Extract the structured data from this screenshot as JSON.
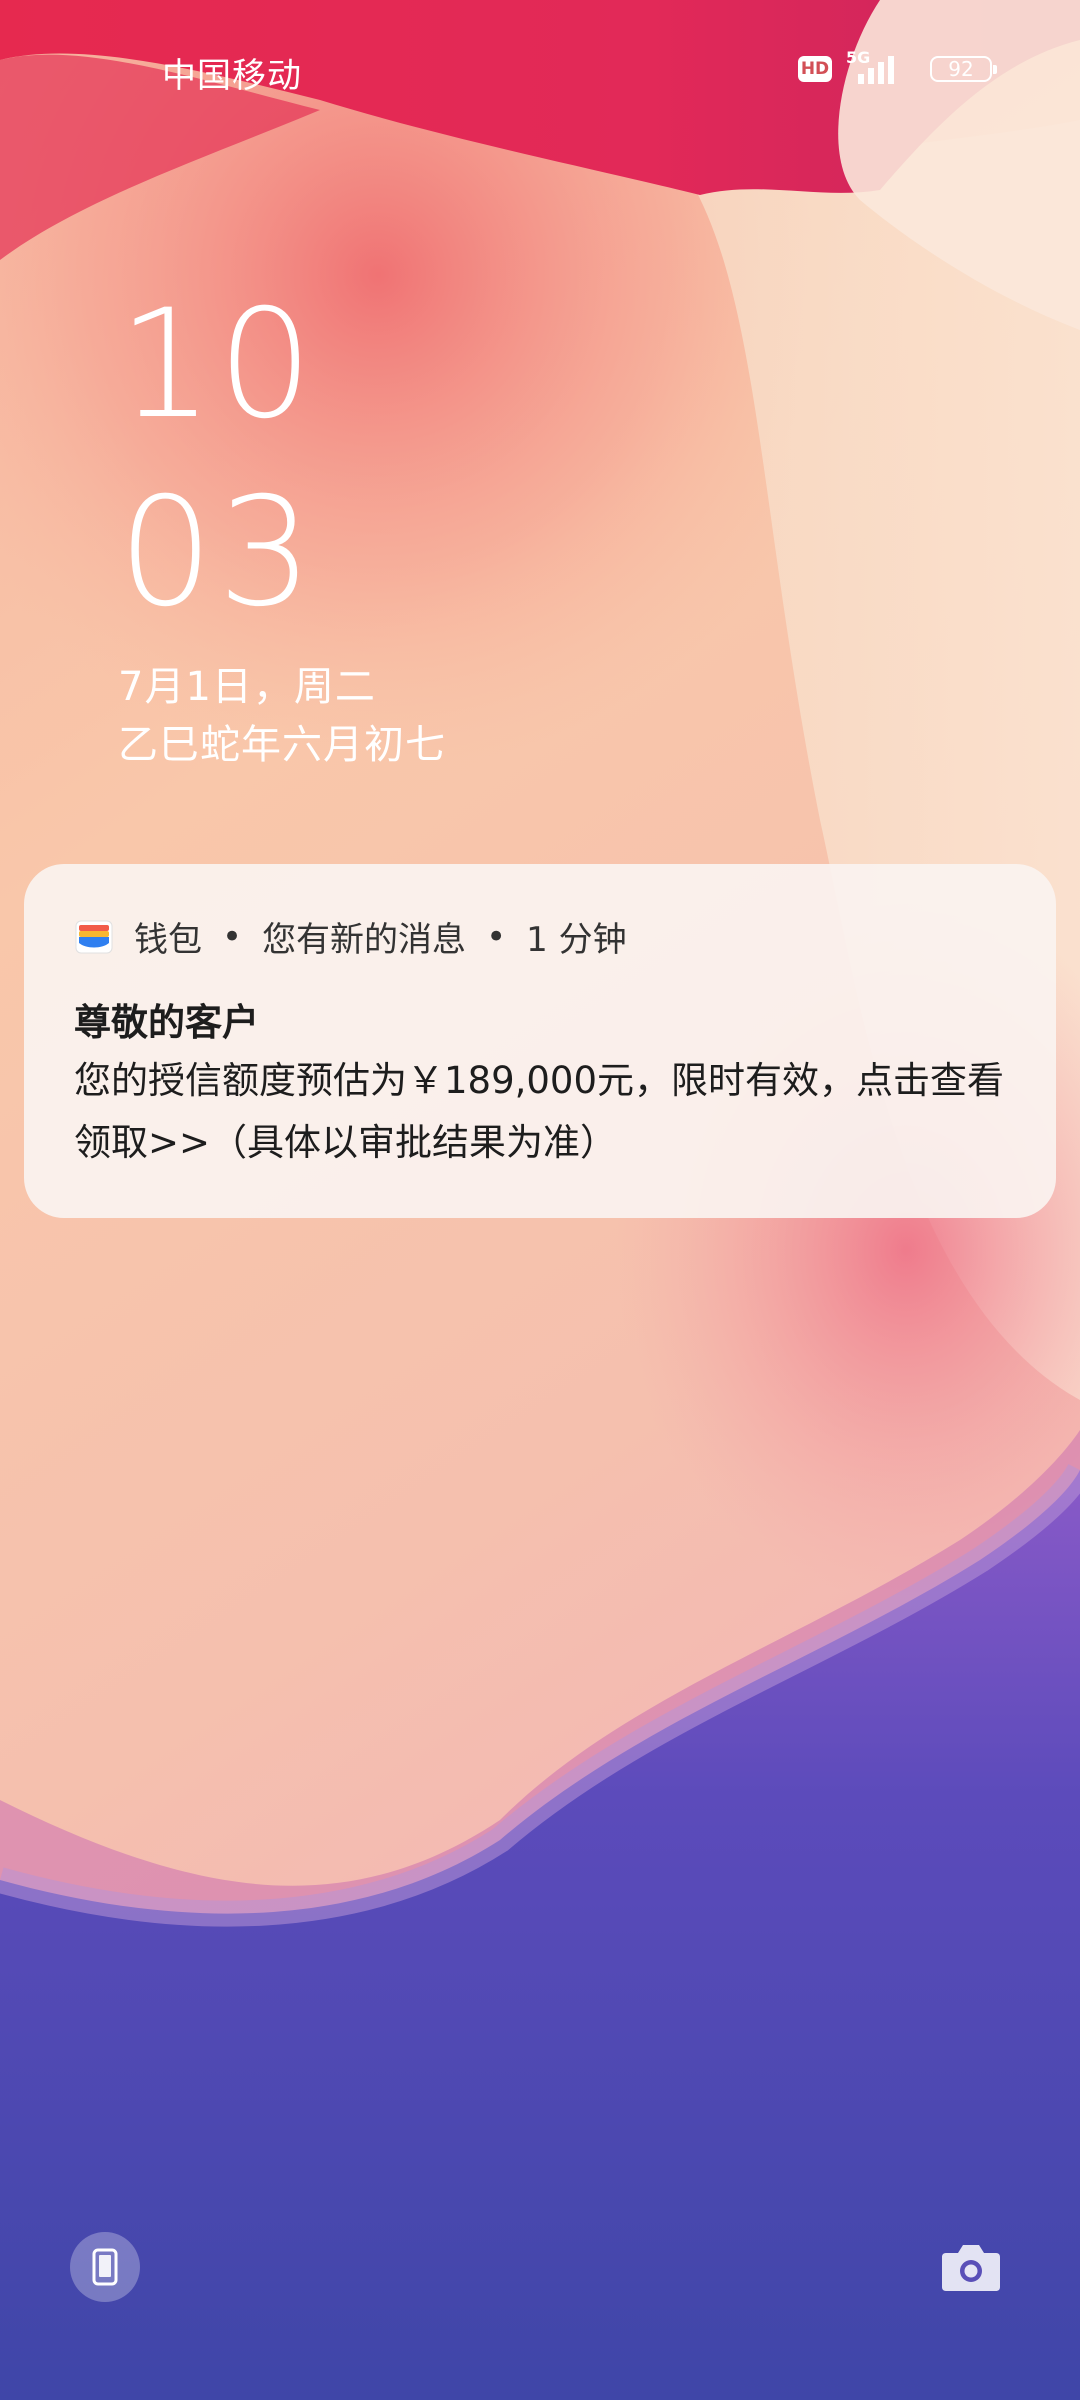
{
  "status_bar": {
    "carrier": "中国移动",
    "hd_label": "HD",
    "network_label": "5G",
    "battery_level": "92"
  },
  "clock": {
    "hour": "10",
    "minute": "03",
    "date": "7月1日，周二",
    "lunar_date": "乙巳蛇年六月初七"
  },
  "notification": {
    "app_name": "钱包",
    "separator_1": "•",
    "summary": "您有新的消息",
    "separator_2": "•",
    "time_ago": "1 分钟",
    "title": "尊敬的客户",
    "body": "您的授信额度预估为￥189,000元，限时有效，点击查看领取>>（具体以审批结果为准）"
  },
  "shortcuts": {
    "left_icon": "phone-icon",
    "right_icon": "camera-icon"
  },
  "colors": {
    "wallpaper_pink": "#e8325a",
    "wallpaper_peach": "#f9c4a6",
    "wallpaper_purple": "#4a47b0",
    "notification_bg": "#faf3f0",
    "text_dark": "#1d1d1d"
  }
}
